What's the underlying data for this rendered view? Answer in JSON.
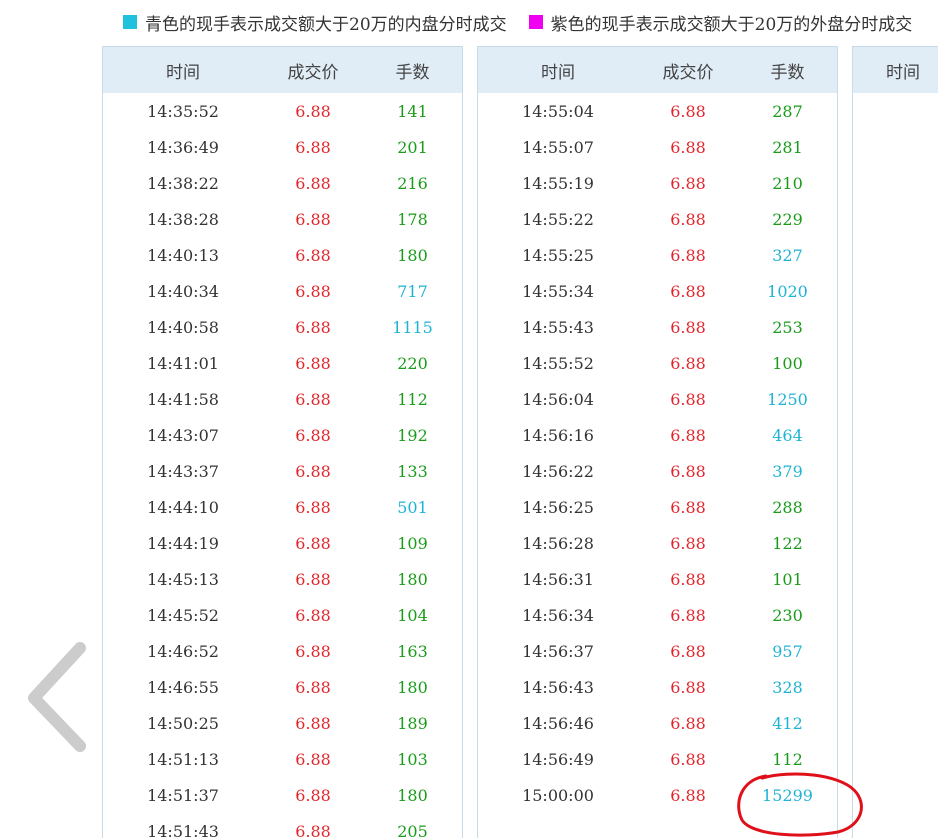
{
  "legend": {
    "cyan_text": "青色的现手表示成交额大于20万的内盘分时成交",
    "magenta_text": "紫色的现手表示成交额大于20万的外盘分时成交",
    "cyan_color": "#1fc1dc",
    "magenta_color": "#f000f0"
  },
  "table": {
    "headers": {
      "time": "时间",
      "price": "成交价",
      "volume": "手数"
    }
  },
  "panels": [
    {
      "rows": [
        {
          "time": "14:35:52",
          "price": "6.88",
          "volume": "141",
          "kind": "normal"
        },
        {
          "time": "14:36:49",
          "price": "6.88",
          "volume": "201",
          "kind": "normal"
        },
        {
          "time": "14:38:22",
          "price": "6.88",
          "volume": "216",
          "kind": "normal"
        },
        {
          "time": "14:38:28",
          "price": "6.88",
          "volume": "178",
          "kind": "normal"
        },
        {
          "time": "14:40:13",
          "price": "6.88",
          "volume": "180",
          "kind": "normal"
        },
        {
          "time": "14:40:34",
          "price": "6.88",
          "volume": "717",
          "kind": "large"
        },
        {
          "time": "14:40:58",
          "price": "6.88",
          "volume": "1115",
          "kind": "large"
        },
        {
          "time": "14:41:01",
          "price": "6.88",
          "volume": "220",
          "kind": "normal"
        },
        {
          "time": "14:41:58",
          "price": "6.88",
          "volume": "112",
          "kind": "normal"
        },
        {
          "time": "14:43:07",
          "price": "6.88",
          "volume": "192",
          "kind": "normal"
        },
        {
          "time": "14:43:37",
          "price": "6.88",
          "volume": "133",
          "kind": "normal"
        },
        {
          "time": "14:44:10",
          "price": "6.88",
          "volume": "501",
          "kind": "large"
        },
        {
          "time": "14:44:19",
          "price": "6.88",
          "volume": "109",
          "kind": "normal"
        },
        {
          "time": "14:45:13",
          "price": "6.88",
          "volume": "180",
          "kind": "normal"
        },
        {
          "time": "14:45:52",
          "price": "6.88",
          "volume": "104",
          "kind": "normal"
        },
        {
          "time": "14:46:52",
          "price": "6.88",
          "volume": "163",
          "kind": "normal"
        },
        {
          "time": "14:46:55",
          "price": "6.88",
          "volume": "180",
          "kind": "normal"
        },
        {
          "time": "14:50:25",
          "price": "6.88",
          "volume": "189",
          "kind": "normal"
        },
        {
          "time": "14:51:13",
          "price": "6.88",
          "volume": "103",
          "kind": "normal"
        },
        {
          "time": "14:51:37",
          "price": "6.88",
          "volume": "180",
          "kind": "normal"
        },
        {
          "time": "14:51:43",
          "price": "6.88",
          "volume": "205",
          "kind": "normal"
        }
      ]
    },
    {
      "rows": [
        {
          "time": "14:55:04",
          "price": "6.88",
          "volume": "287",
          "kind": "normal"
        },
        {
          "time": "14:55:07",
          "price": "6.88",
          "volume": "281",
          "kind": "normal"
        },
        {
          "time": "14:55:19",
          "price": "6.88",
          "volume": "210",
          "kind": "normal"
        },
        {
          "time": "14:55:22",
          "price": "6.88",
          "volume": "229",
          "kind": "normal"
        },
        {
          "time": "14:55:25",
          "price": "6.88",
          "volume": "327",
          "kind": "large"
        },
        {
          "time": "14:55:34",
          "price": "6.88",
          "volume": "1020",
          "kind": "large"
        },
        {
          "time": "14:55:43",
          "price": "6.88",
          "volume": "253",
          "kind": "normal"
        },
        {
          "time": "14:55:52",
          "price": "6.88",
          "volume": "100",
          "kind": "normal"
        },
        {
          "time": "14:56:04",
          "price": "6.88",
          "volume": "1250",
          "kind": "large"
        },
        {
          "time": "14:56:16",
          "price": "6.88",
          "volume": "464",
          "kind": "large"
        },
        {
          "time": "14:56:22",
          "price": "6.88",
          "volume": "379",
          "kind": "large"
        },
        {
          "time": "14:56:25",
          "price": "6.88",
          "volume": "288",
          "kind": "normal"
        },
        {
          "time": "14:56:28",
          "price": "6.88",
          "volume": "122",
          "kind": "normal"
        },
        {
          "time": "14:56:31",
          "price": "6.88",
          "volume": "101",
          "kind": "normal"
        },
        {
          "time": "14:56:34",
          "price": "6.88",
          "volume": "230",
          "kind": "normal"
        },
        {
          "time": "14:56:37",
          "price": "6.88",
          "volume": "957",
          "kind": "large"
        },
        {
          "time": "14:56:43",
          "price": "6.88",
          "volume": "328",
          "kind": "large"
        },
        {
          "time": "14:56:46",
          "price": "6.88",
          "volume": "412",
          "kind": "large"
        },
        {
          "time": "14:56:49",
          "price": "6.88",
          "volume": "112",
          "kind": "normal"
        },
        {
          "time": "15:00:00",
          "price": "6.88",
          "volume": "15299",
          "kind": "large"
        }
      ]
    },
    {
      "rows": []
    }
  ],
  "colors": {
    "price": "#e3262c",
    "volume_normal": "#1a9b1a",
    "volume_large": "#1fb3d4",
    "header_bg": "#e1edf6",
    "annotation_circle": "#e0101a"
  },
  "icons": {
    "back": "chevron-left-icon"
  }
}
